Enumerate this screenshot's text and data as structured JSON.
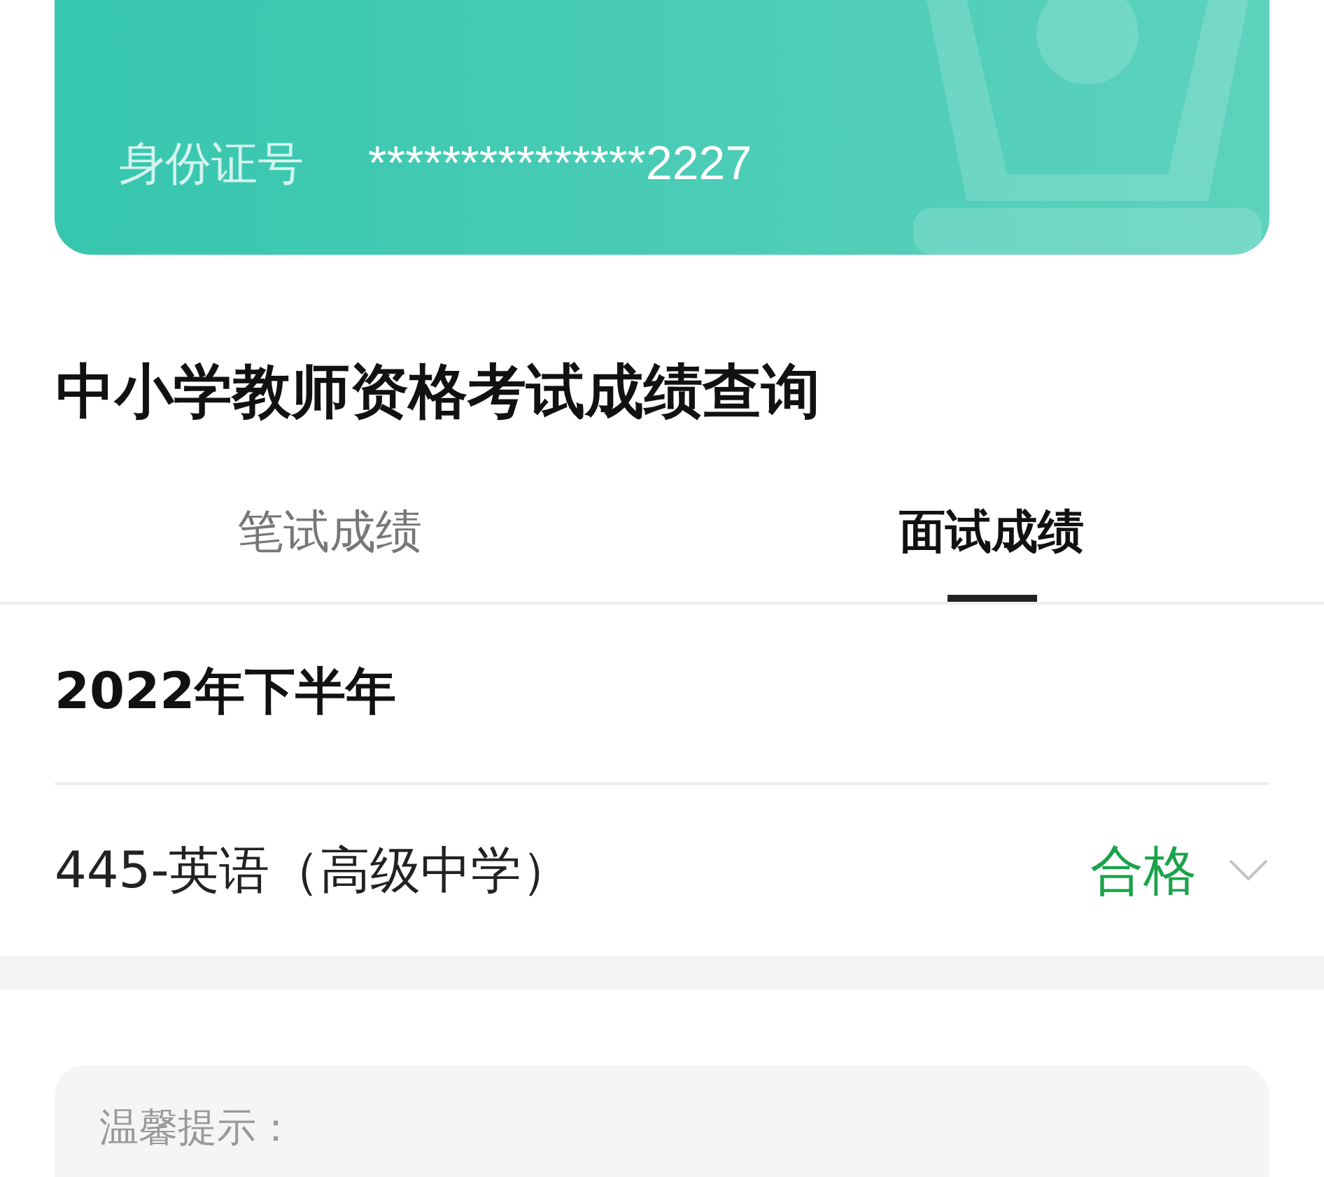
{
  "id_card": {
    "label": "身份证号",
    "value": "***************2227"
  },
  "title": "中小学教师资格考试成绩查询",
  "tabs": [
    {
      "label": "笔试成绩",
      "selected": false
    },
    {
      "label": "面试成绩",
      "selected": true
    }
  ],
  "period": "2022年下半年",
  "results": [
    {
      "subject": "445-英语（高级中学）",
      "status": "合格",
      "color": "#1aa34a",
      "expanded": false
    }
  ],
  "tips": {
    "title": "温馨提示："
  }
}
